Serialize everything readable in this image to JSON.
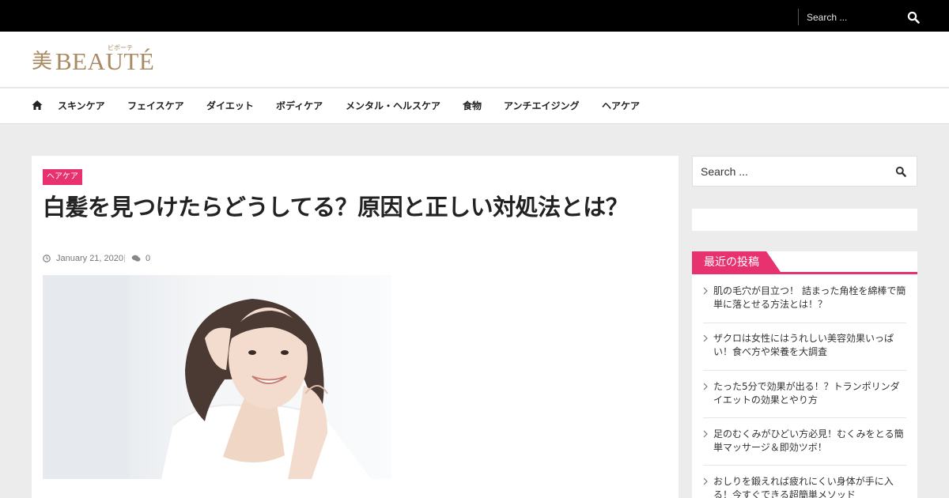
{
  "topbar": {
    "search_placeholder": "Search ..."
  },
  "logo": {
    "kanji": "美",
    "word": "BEAUTÉ",
    "ruby": "ビボーテ"
  },
  "nav": {
    "items": [
      "スキンケア",
      "フェイスケア",
      "ダイエット",
      "ボディケア",
      "メンタル・ヘルスケア",
      "食物",
      "アンチエイジング",
      "ヘアケア"
    ]
  },
  "article": {
    "category": "ヘアケア",
    "title": "白髪を見つけたらどうしてる？原因と正しい対処法とは？",
    "date": "January 21, 2020",
    "comment_count": "0"
  },
  "sidebar": {
    "search_placeholder": "Search ...",
    "recent_title": "最近の投稿",
    "recent_posts": [
      "肌の毛穴が目立つ！ 詰まった角栓を綿棒で簡単に落とせる方法とは！？",
      "ザクロは女性にはうれしい美容効果いっぱい！食べ方や栄養を大調査",
      "たった5分で効果が出る！？トランポリンダイエットの効果とやり方",
      "足のむくみがひどい方必見！むくみをとる簡単マッサージ＆即効ツボ！",
      "おしりを鍛えれば疲れにくい身体が手に入る！今すぐできる超簡単メソッド"
    ]
  },
  "colors": {
    "accent": "#e8326f",
    "logo": "#a88a63",
    "topbar": "#000000",
    "page_bg": "#ececec"
  }
}
